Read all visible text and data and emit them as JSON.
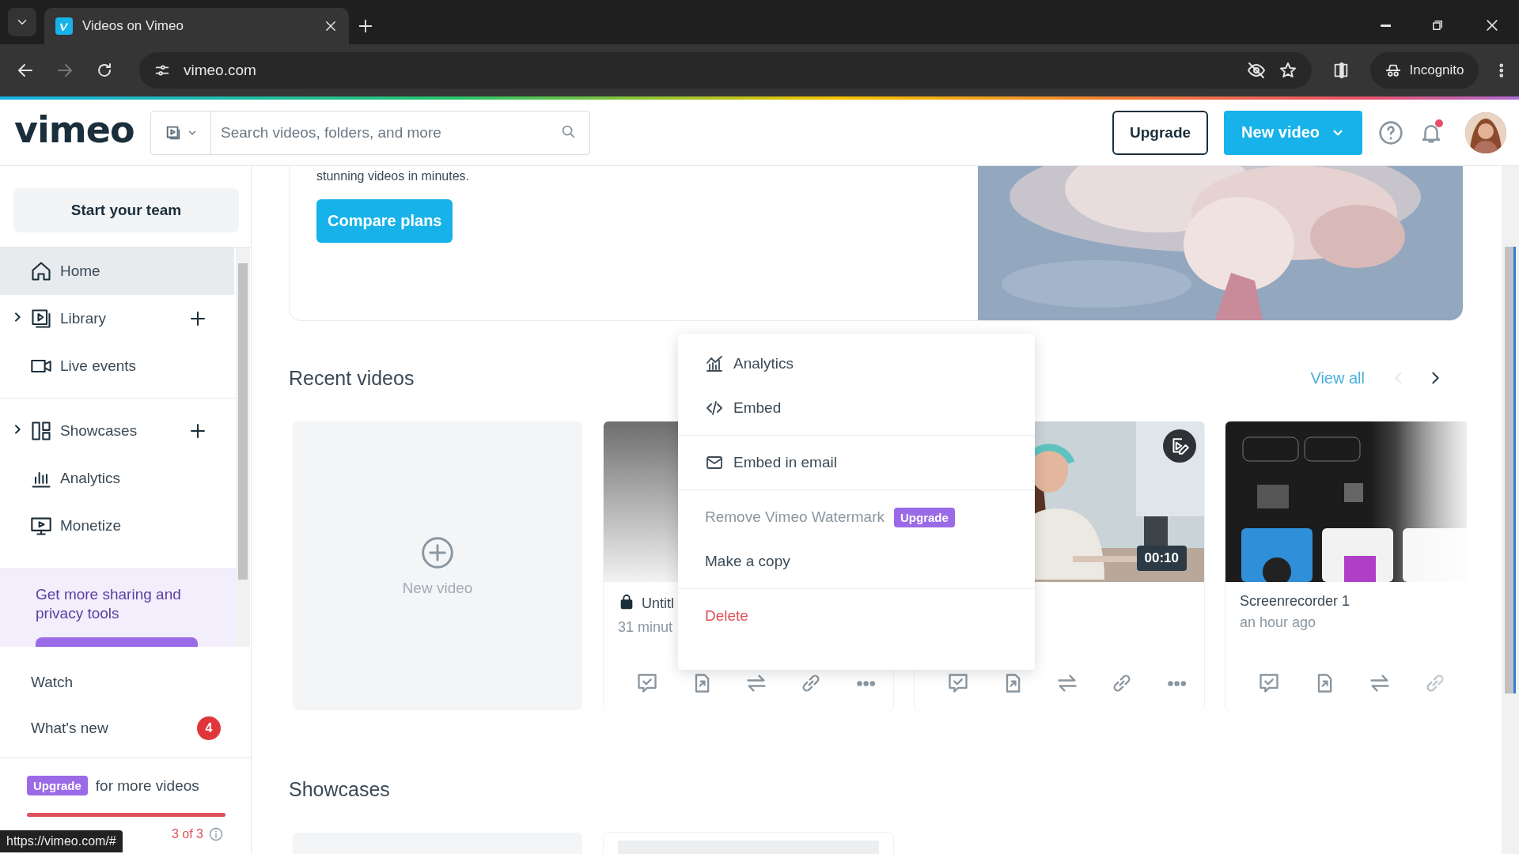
{
  "browser": {
    "tab_title": "Videos on Vimeo",
    "url": "vimeo.com",
    "profile": "Incognito",
    "forward_disabled": true
  },
  "header": {
    "logo": "vimeo",
    "search": {
      "placeholder": "Search videos, folders, and more"
    },
    "upgrade": "Upgrade",
    "new_video": "New video",
    "notifications_unread": true
  },
  "sidebar": {
    "team_button": "Start your team",
    "nav": [
      {
        "label": "Home",
        "selected": true,
        "expandable": false,
        "addable": false
      },
      {
        "label": "Library",
        "selected": false,
        "expandable": true,
        "addable": true
      },
      {
        "label": "Live events",
        "selected": false,
        "expandable": false,
        "addable": false
      },
      {
        "label": "Showcases",
        "selected": false,
        "expandable": true,
        "addable": true
      },
      {
        "label": "Analytics",
        "selected": false,
        "expandable": false,
        "addable": false
      },
      {
        "label": "Monetize",
        "selected": false,
        "expandable": false,
        "addable": false
      }
    ],
    "promo": {
      "text": "Get more sharing and privacy tools"
    },
    "links": [
      {
        "label": "Watch"
      },
      {
        "label": "What's new",
        "badge": "4"
      }
    ],
    "quota": {
      "badge": "Upgrade",
      "text": "for more videos",
      "level": 1,
      "count": "3 of 3"
    }
  },
  "hero": {
    "text": "stunning videos in minutes.",
    "button": "Compare plans"
  },
  "recent": {
    "title": "Recent videos",
    "view_all": "View all",
    "prev_disabled": true,
    "cards": [
      {
        "kind": "new",
        "label": "New video"
      },
      {
        "kind": "video",
        "locked": true,
        "title": "Untitl",
        "time": "31 minut"
      },
      {
        "kind": "video",
        "duration": "00:10"
      },
      {
        "kind": "video",
        "locked": false,
        "title": "Screenrecorder 1",
        "time": "an hour ago"
      }
    ]
  },
  "menu": {
    "groups": [
      {
        "items": [
          {
            "label": "Analytics",
            "disabled": false,
            "danger": false
          },
          {
            "label": "Embed",
            "disabled": false,
            "danger": false
          }
        ]
      },
      {
        "items": [
          {
            "label": "Embed in email",
            "disabled": false,
            "danger": false
          }
        ]
      },
      {
        "items": [
          {
            "label": "Remove Vimeo Watermark",
            "badge": "Upgrade",
            "disabled": true,
            "danger": false
          },
          {
            "label": "Make a copy",
            "disabled": false,
            "danger": false
          }
        ]
      },
      {
        "items": [
          {
            "label": "Delete",
            "disabled": false,
            "danger": true
          }
        ]
      }
    ]
  },
  "showcases": {
    "title": "Showcases",
    "cards": [
      {
        "kind": "empty"
      },
      {
        "kind": "showcase"
      }
    ]
  },
  "status_url": "https://vimeo.com/#"
}
